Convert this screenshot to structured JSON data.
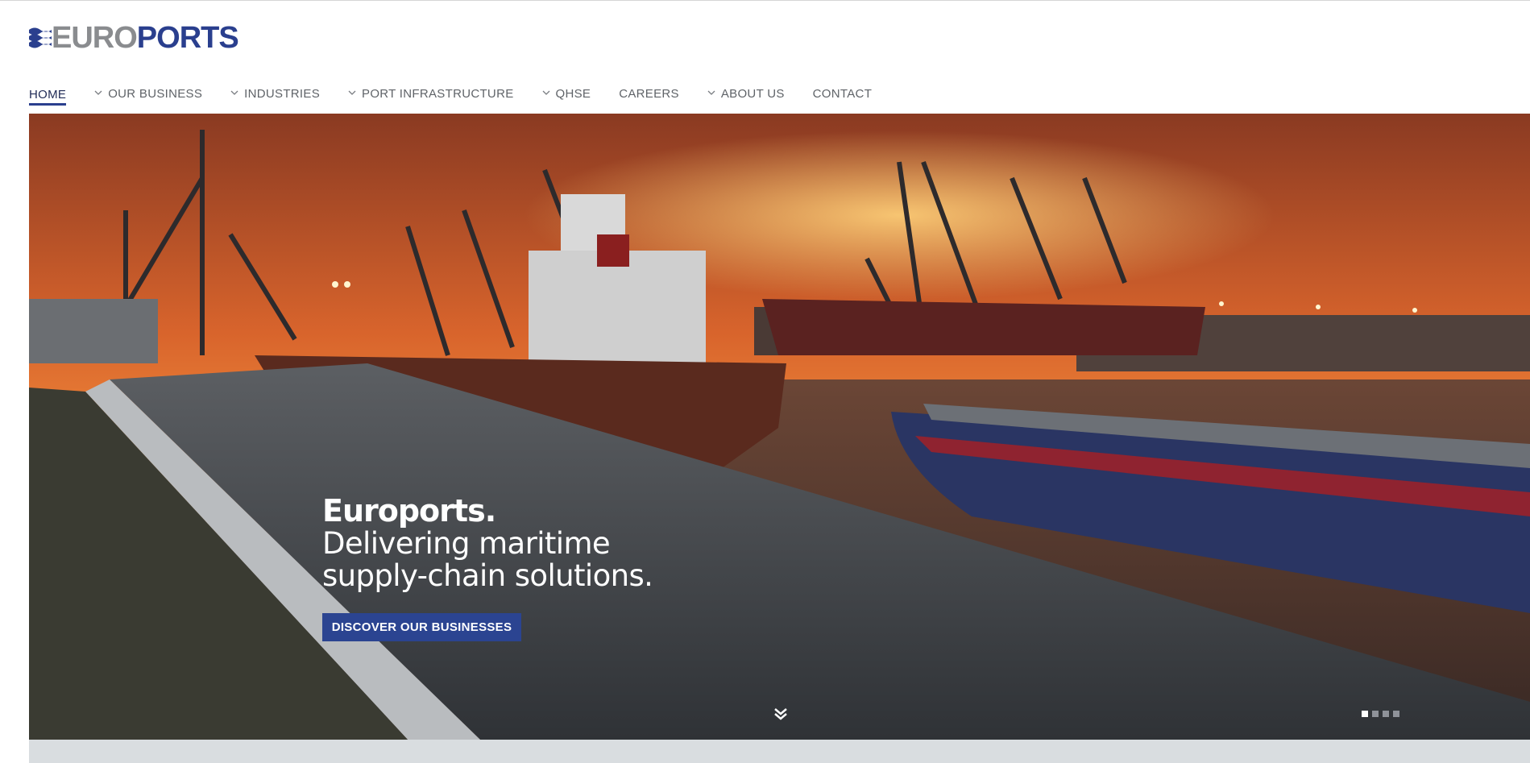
{
  "brand": {
    "logo_left": "EURO",
    "logo_right": "PORTS",
    "colors": {
      "grey": "#8a8c8f",
      "blue": "#2a3f8e"
    }
  },
  "nav": {
    "items": [
      {
        "label": "HOME",
        "active": true,
        "dropdown": false
      },
      {
        "label": "OUR BUSINESS",
        "active": false,
        "dropdown": true
      },
      {
        "label": "INDUSTRIES",
        "active": false,
        "dropdown": true
      },
      {
        "label": "PORT INFRASTRUCTURE",
        "active": false,
        "dropdown": true
      },
      {
        "label": "QHSE",
        "active": false,
        "dropdown": true
      },
      {
        "label": "CAREERS",
        "active": false,
        "dropdown": false
      },
      {
        "label": "ABOUT US",
        "active": false,
        "dropdown": true
      },
      {
        "label": "CONTACT",
        "active": false,
        "dropdown": false
      }
    ]
  },
  "hero": {
    "image_subject": "cargo ships and harbour cranes at a port during sunset",
    "title": "Euroports.",
    "subtitle_line1": "Delivering maritime",
    "subtitle_line2": "supply-chain solutions.",
    "cta_label": "DISCOVER OUR BUSINESSES",
    "scroll_icon": "double-chevron-down-icon",
    "slider": {
      "count": 4,
      "active_index": 0
    }
  },
  "colors": {
    "accent": "#2b4491",
    "nav_text": "#5f6368",
    "band": "#d9dde0"
  }
}
